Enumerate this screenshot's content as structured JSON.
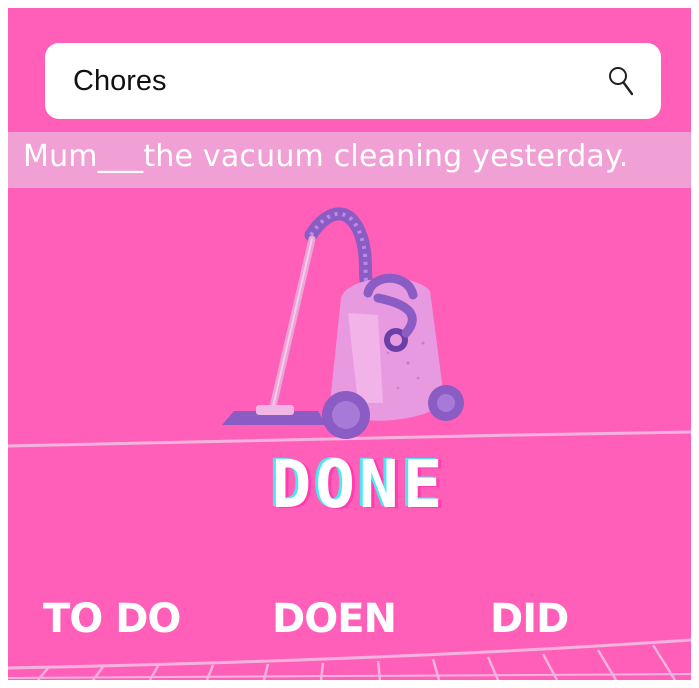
{
  "search": {
    "value": "Chores"
  },
  "question": {
    "text": "Mum___the vacuum cleaning yesterday."
  },
  "illustration": {
    "icon": "vacuum-cleaner-icon",
    "word": "DONE"
  },
  "choices": [
    {
      "label": "TO DO"
    },
    {
      "label": "DOEN"
    },
    {
      "label": "DID"
    }
  ],
  "colors": {
    "background": "#ff5fb8",
    "band": "#f0a6d8",
    "vacuum_body": "#e89ae0",
    "vacuum_dark": "#8a5cc4",
    "text": "#ffffff"
  }
}
